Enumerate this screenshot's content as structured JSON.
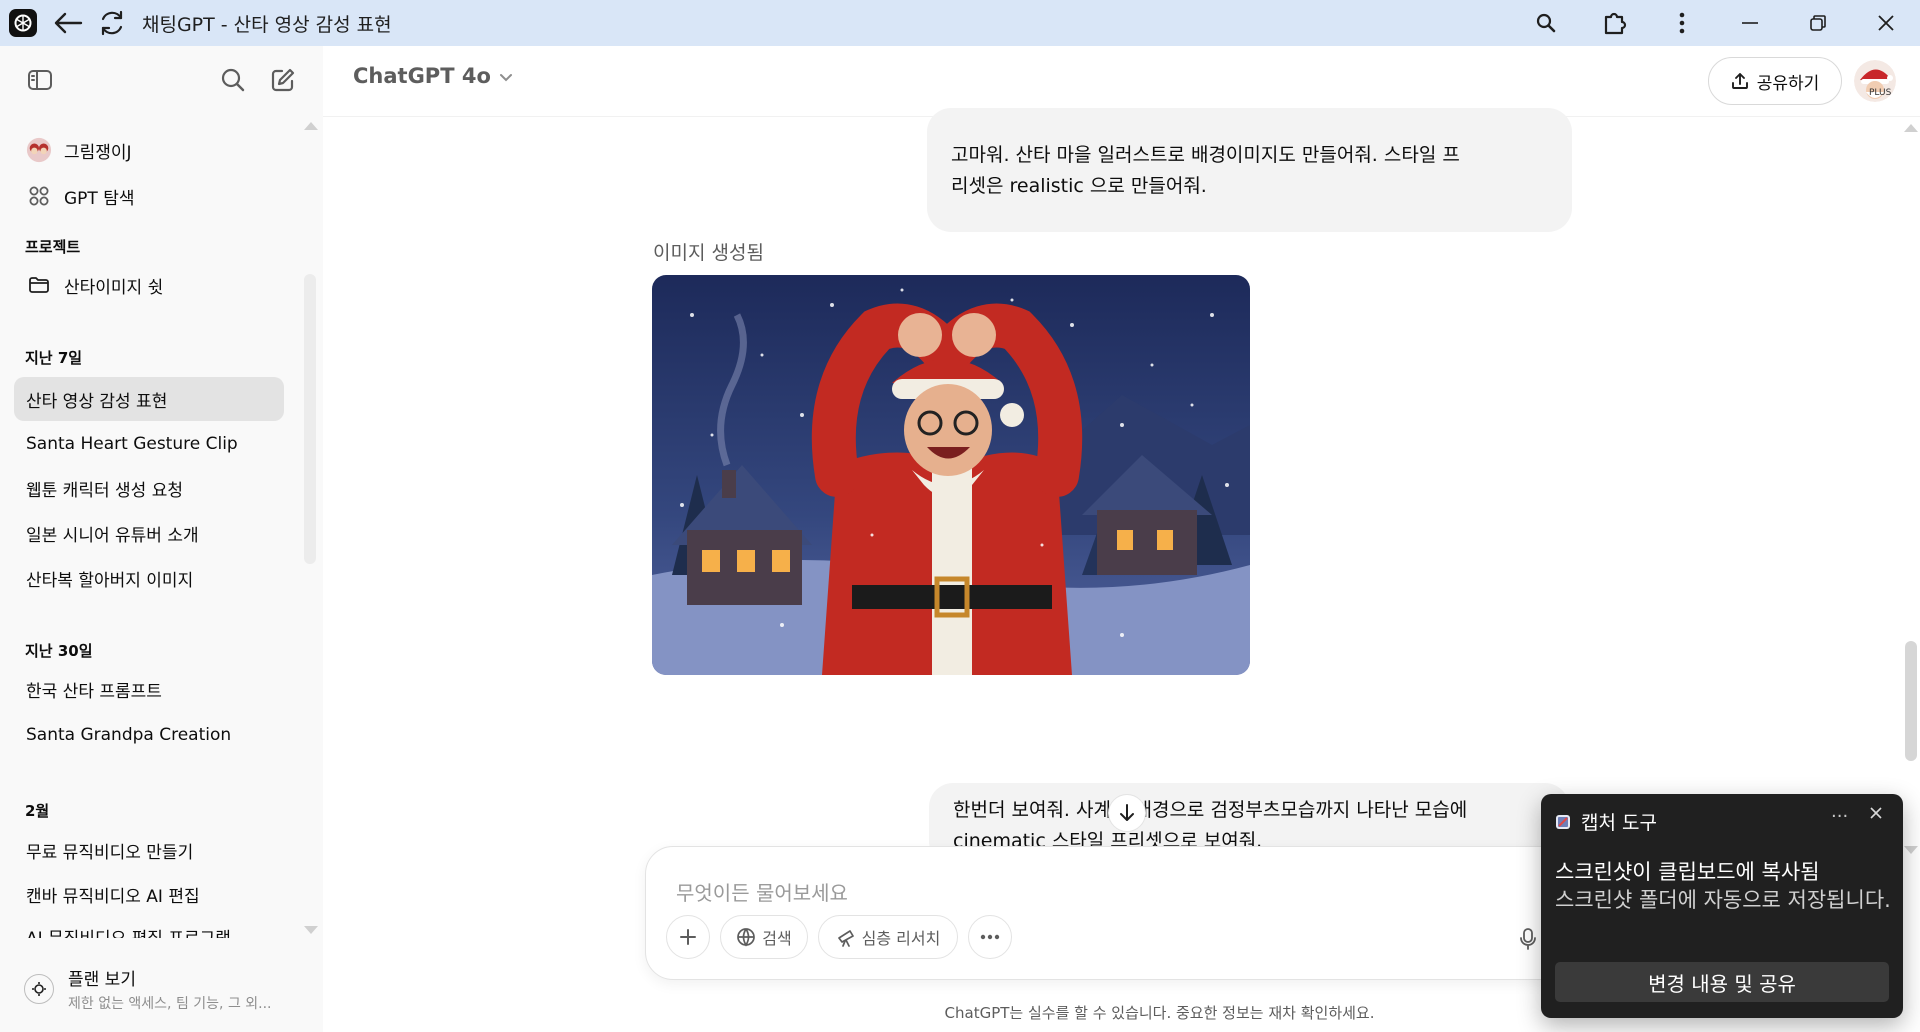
{
  "window": {
    "title": "채팅GPT - 산타 영상 감성 표현"
  },
  "sidebar": {
    "top_items": [
      {
        "label": "그림쟁이J",
        "icon": "avatar-icon"
      },
      {
        "label": "GPT 탐색",
        "icon": "grid-icon"
      }
    ],
    "sections": [
      {
        "title": "프로젝트",
        "items": [
          "산타이미지 쉿"
        ]
      },
      {
        "title": "지난 7일",
        "items": [
          "산타 영상 감성 표현",
          "Santa Heart Gesture Clip",
          "웹툰 캐릭터 생성 요청",
          "일본 시니어 유튜버 소개",
          "산타복 할아버지 이미지"
        ]
      },
      {
        "title": "지난 30일",
        "items": [
          "한국 산타 프롬프트",
          "Santa Grandpa Creation"
        ]
      },
      {
        "title": "2월",
        "items": [
          "무료 뮤직비디오 만들기",
          "캔바 뮤직비디오 AI 편집",
          "AI 뮤직비디오 편집 프로그램"
        ]
      }
    ],
    "active_item": "산타 영상 감성 표현",
    "plan": {
      "title": "플랜 보기",
      "subtitle": "제한 없는 액세스, 팀 기능, 그 외..."
    }
  },
  "header": {
    "model": "ChatGPT 4o",
    "share_label": "공유하기",
    "plan_badge": "PLUS"
  },
  "chat": {
    "message_1": [
      "고마워. 산타 마을  일러스트로 배경이미지도 만들어줘. 스타일 프",
      "리셋은 realistic 으로 만들어줘."
    ],
    "image_label": "이미지 생성됨",
    "message_2": [
      "한번더 보여줘. 사계절 배경으로 검정부츠모습까지 나타난 모습에",
      "cinematic 스타일 프리셋으로 보여줘."
    ]
  },
  "composer": {
    "placeholder": "무엇이든 물어보세요",
    "search_label": "검색",
    "research_label": "심층 리서치"
  },
  "disclaimer": "ChatGPT는 실수를 할 수 있습니다. 중요한 정보는 재차 확인하세요.",
  "toast": {
    "app_name": "캡처 도구",
    "title": "스크린샷이 클립보드에 복사됨",
    "body": "스크린샷 폴더에 자동으로 저장됩니다.",
    "action": "변경 내용 및 공유",
    "more": "···"
  }
}
